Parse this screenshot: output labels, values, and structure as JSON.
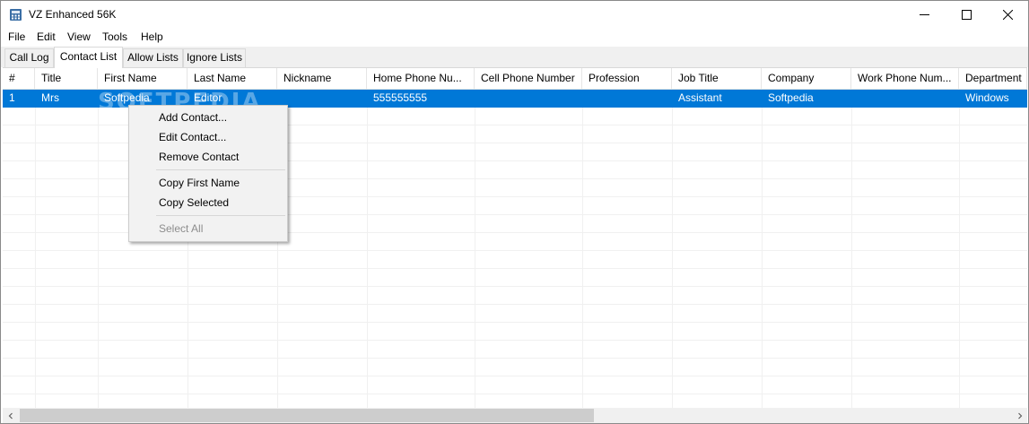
{
  "window": {
    "title": "VZ Enhanced 56K"
  },
  "menu": [
    "File",
    "Edit",
    "View",
    "Tools",
    "Help"
  ],
  "tabs": [
    {
      "label": "Call Log",
      "active": false
    },
    {
      "label": "Contact List",
      "active": true
    },
    {
      "label": "Allow Lists",
      "active": false
    },
    {
      "label": "Ignore Lists",
      "active": false
    }
  ],
  "table": {
    "columns": [
      "#",
      "Title",
      "First Name",
      "Last Name",
      "Nickname",
      "Home Phone Nu...",
      "Cell Phone Number",
      "Profession",
      "Job Title",
      "Company",
      "Work Phone Num...",
      "Department"
    ],
    "rows": [
      [
        "1",
        "Mrs",
        "Softpedia",
        "Editor",
        "",
        "555555555",
        "",
        "",
        "Assistant",
        "Softpedia",
        "",
        "Windows"
      ]
    ],
    "selected_row": 0
  },
  "watermark": "SOFTPEDIA",
  "context_menu": {
    "items": [
      {
        "label": "Add Contact...",
        "enabled": true
      },
      {
        "label": "Edit Contact...",
        "enabled": true
      },
      {
        "label": "Remove Contact",
        "enabled": true
      },
      {
        "label": "Copy First Name",
        "enabled": true
      },
      {
        "label": "Copy Selected",
        "enabled": true
      },
      {
        "label": "Select All",
        "enabled": false
      }
    ]
  },
  "colors": {
    "selection": "#0078d7",
    "tab_bg": "#f0f0f0",
    "menu_bg": "#f2f2f2"
  }
}
